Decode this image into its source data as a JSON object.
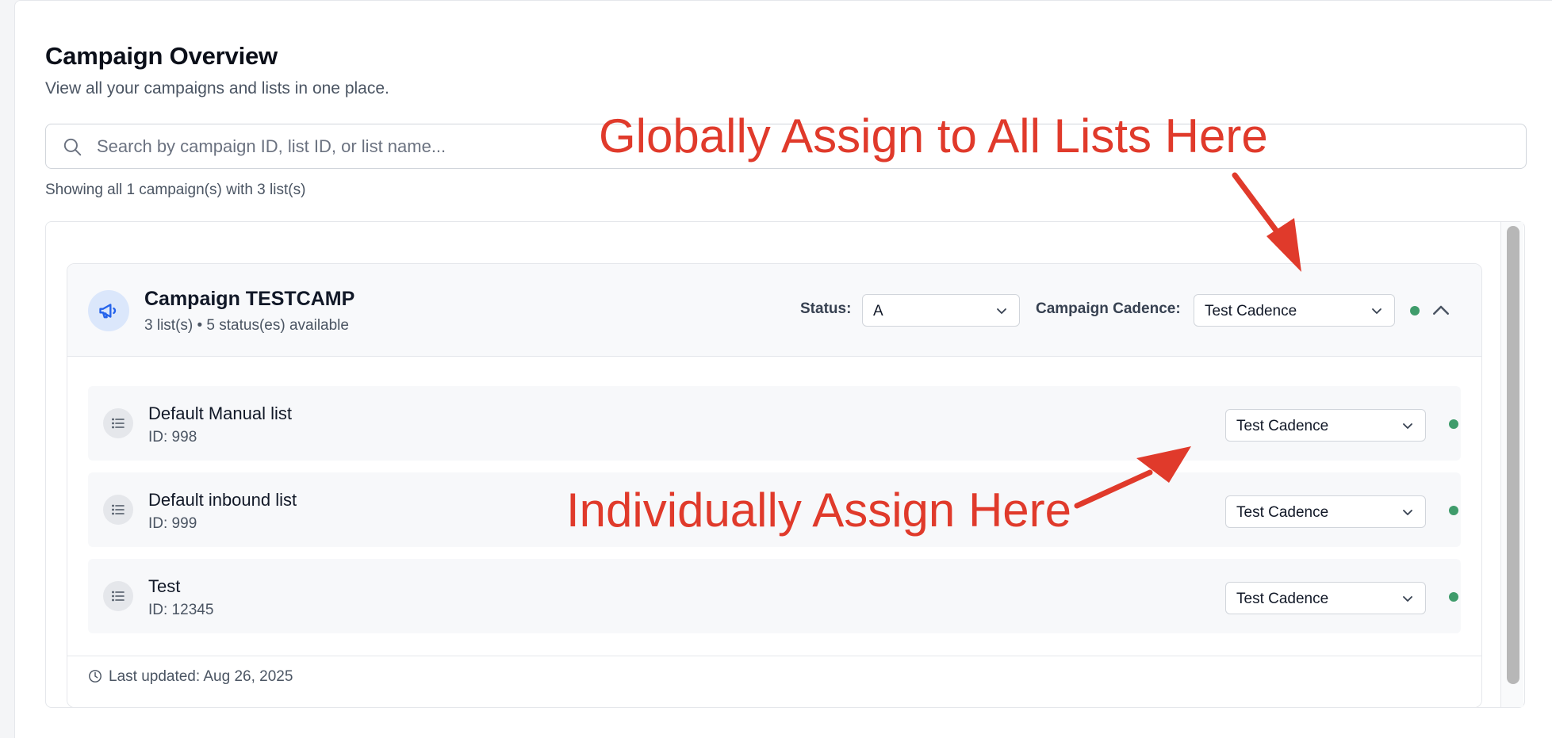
{
  "page": {
    "title": "Campaign Overview",
    "subtitle": "View all your campaigns and lists in one place."
  },
  "search": {
    "placeholder": "Search by campaign ID, list ID, or list name...",
    "value": ""
  },
  "result_summary": "Showing all 1 campaign(s) with 3 list(s)",
  "campaign": {
    "name": "Campaign TESTCAMP",
    "meta": "3 list(s) • 5 status(es) available",
    "status_label": "Status:",
    "status_value": "A",
    "cadence_label": "Campaign Cadence:",
    "cadence_value": "Test Cadence",
    "lists": [
      {
        "name": "Default Manual list",
        "id": "ID: 998",
        "cadence": "Test Cadence"
      },
      {
        "name": "Default inbound list",
        "id": "ID: 999",
        "cadence": "Test Cadence"
      },
      {
        "name": "Test",
        "id": "ID: 12345",
        "cadence": "Test Cadence"
      }
    ],
    "last_updated": "Last updated: Aug 26, 2025"
  },
  "annotations": {
    "global": "Globally Assign to All Lists Here",
    "individual": "Individually Assign Here"
  },
  "colors": {
    "annotation": "#e03a2b",
    "status_dot": "#3f9c6b",
    "megaphone": "#2563eb"
  },
  "icons": [
    "search-icon",
    "megaphone-icon",
    "chevron-down-icon",
    "chevron-up-icon",
    "list-icon",
    "clock-icon"
  ]
}
